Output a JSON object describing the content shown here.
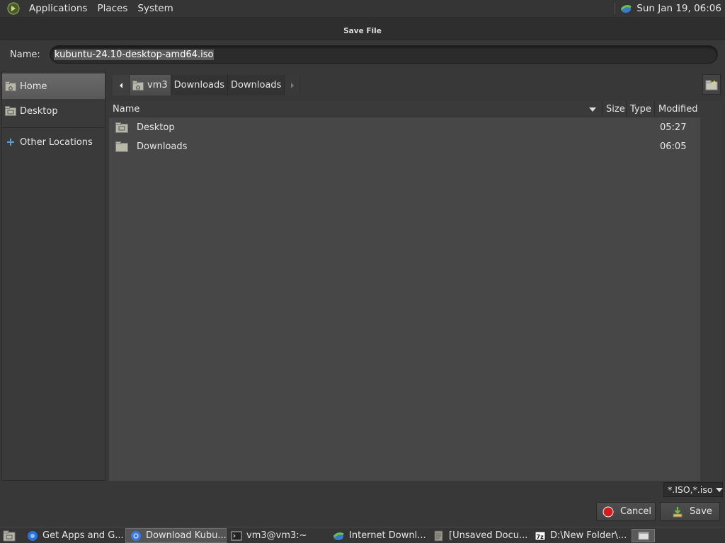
{
  "top_panel": {
    "menus": [
      "Applications",
      "Places",
      "System"
    ],
    "clock": "Sun Jan 19, 06:06"
  },
  "dialog": {
    "title": "Save File",
    "name_label": "Name:",
    "name_value": "kubuntu-24.10-desktop-amd64.iso",
    "sidebar": {
      "items": [
        {
          "label": "Home",
          "icon": "home-folder-icon",
          "active": true
        },
        {
          "label": "Desktop",
          "icon": "desktop-folder-icon",
          "active": false
        },
        {
          "label": "Other Locations",
          "icon": "plus-icon",
          "active": false
        }
      ]
    },
    "pathbar": {
      "segments": [
        "vm3",
        "Downloads",
        "Downloads"
      ]
    },
    "columns": {
      "name": "Name",
      "size": "Size",
      "type": "Type",
      "modified": "Modified"
    },
    "files": [
      {
        "name": "Desktop",
        "modified": "05:27",
        "icon": "desktop-folder-icon"
      },
      {
        "name": "Downloads",
        "modified": "06:05",
        "icon": "folder-icon"
      }
    ],
    "filter": "*.ISO,*.iso",
    "buttons": {
      "cancel": "Cancel",
      "save": "Save"
    }
  },
  "taskbar": {
    "tasks": [
      {
        "label": "Get Apps and G...",
        "icon": "browser-icon"
      },
      {
        "label": "Download Kubu...",
        "icon": "chrome-icon",
        "active": true
      },
      {
        "label": "vm3@vm3:~",
        "icon": "terminal-icon"
      },
      {
        "label": "Internet Downl...",
        "icon": "download-manager-icon"
      },
      {
        "label": "[Unsaved Docu...",
        "icon": "text-editor-icon"
      },
      {
        "label": "D:\\New Folder\\...",
        "icon": "7zip-icon"
      }
    ]
  }
}
